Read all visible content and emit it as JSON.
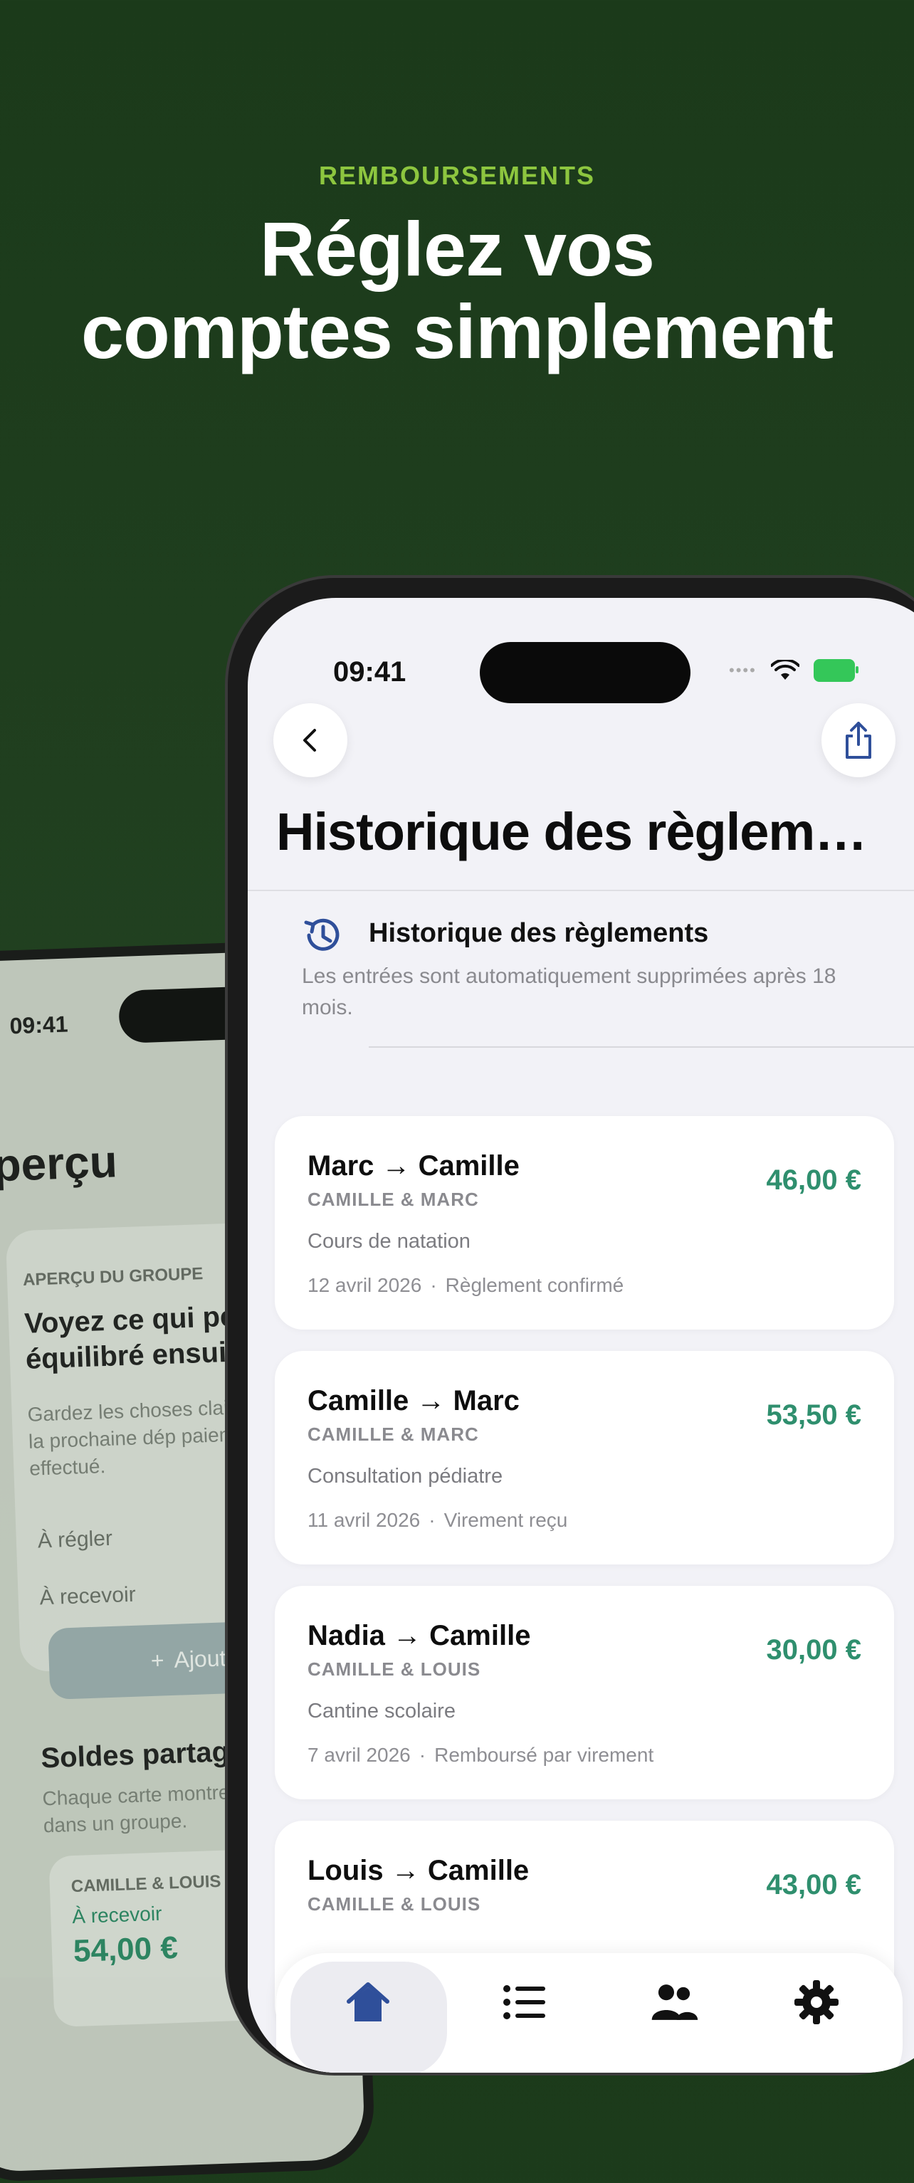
{
  "hero": {
    "eyebrow": "REMBOURSEMENTS",
    "title_line1": "Réglez vos",
    "title_line2": "comptes simplement"
  },
  "back_phone": {
    "time": "09:41",
    "title": "perçu",
    "eyebrow": "APERÇU DU GROUPE",
    "heading": "Voyez ce qui peut équilibré ensuite",
    "body": "Gardez les choses claires ajoutez la prochaine dép paiement déjà effectué.",
    "row_pay": "À régler",
    "row_receive": "À recevoir",
    "add_label": "Ajouter",
    "section_title": "Soldes partagés",
    "section_body": "Chaque carte montre où partagé dans un groupe.",
    "mini_group": "CAMILLE & LOUIS",
    "mini_label": "À recevoir",
    "mini_value": "54,00 €"
  },
  "status": {
    "time": "09:41"
  },
  "screen": {
    "title": "Historique des règlem…",
    "info_title": "Historique des règlements",
    "info_body": "Les entrées sont automatiquement supprimées après 18 mois."
  },
  "settlements": [
    {
      "pair": "Marc → Camille",
      "group": "CAMILLE & MARC",
      "desc": "Cours de natation",
      "date": "12 avril 2026",
      "status": "Règlement confirmé",
      "amount": "46,00 €"
    },
    {
      "pair": "Camille → Marc",
      "group": "CAMILLE & MARC",
      "desc": "Consultation pédiatre",
      "date": "11 avril 2026",
      "status": "Virement reçu",
      "amount": "53,50 €"
    },
    {
      "pair": "Nadia → Camille",
      "group": "CAMILLE & LOUIS",
      "desc": "Cantine scolaire",
      "date": "7 avril 2026",
      "status": "Remboursé par virement",
      "amount": "30,00 €"
    },
    {
      "pair": "Louis → Camille",
      "group": "CAMILLE & LOUIS",
      "desc": "",
      "date": "",
      "status": "",
      "amount": "43,00 €"
    }
  ],
  "meta_separator": "·",
  "colors": {
    "accent_green": "#2f8f6e",
    "eyebrow_green": "#8dc63f",
    "tab_blue": "#2f4f9a"
  },
  "tabs": [
    "home-icon",
    "list-icon",
    "people-icon",
    "gear-icon"
  ]
}
